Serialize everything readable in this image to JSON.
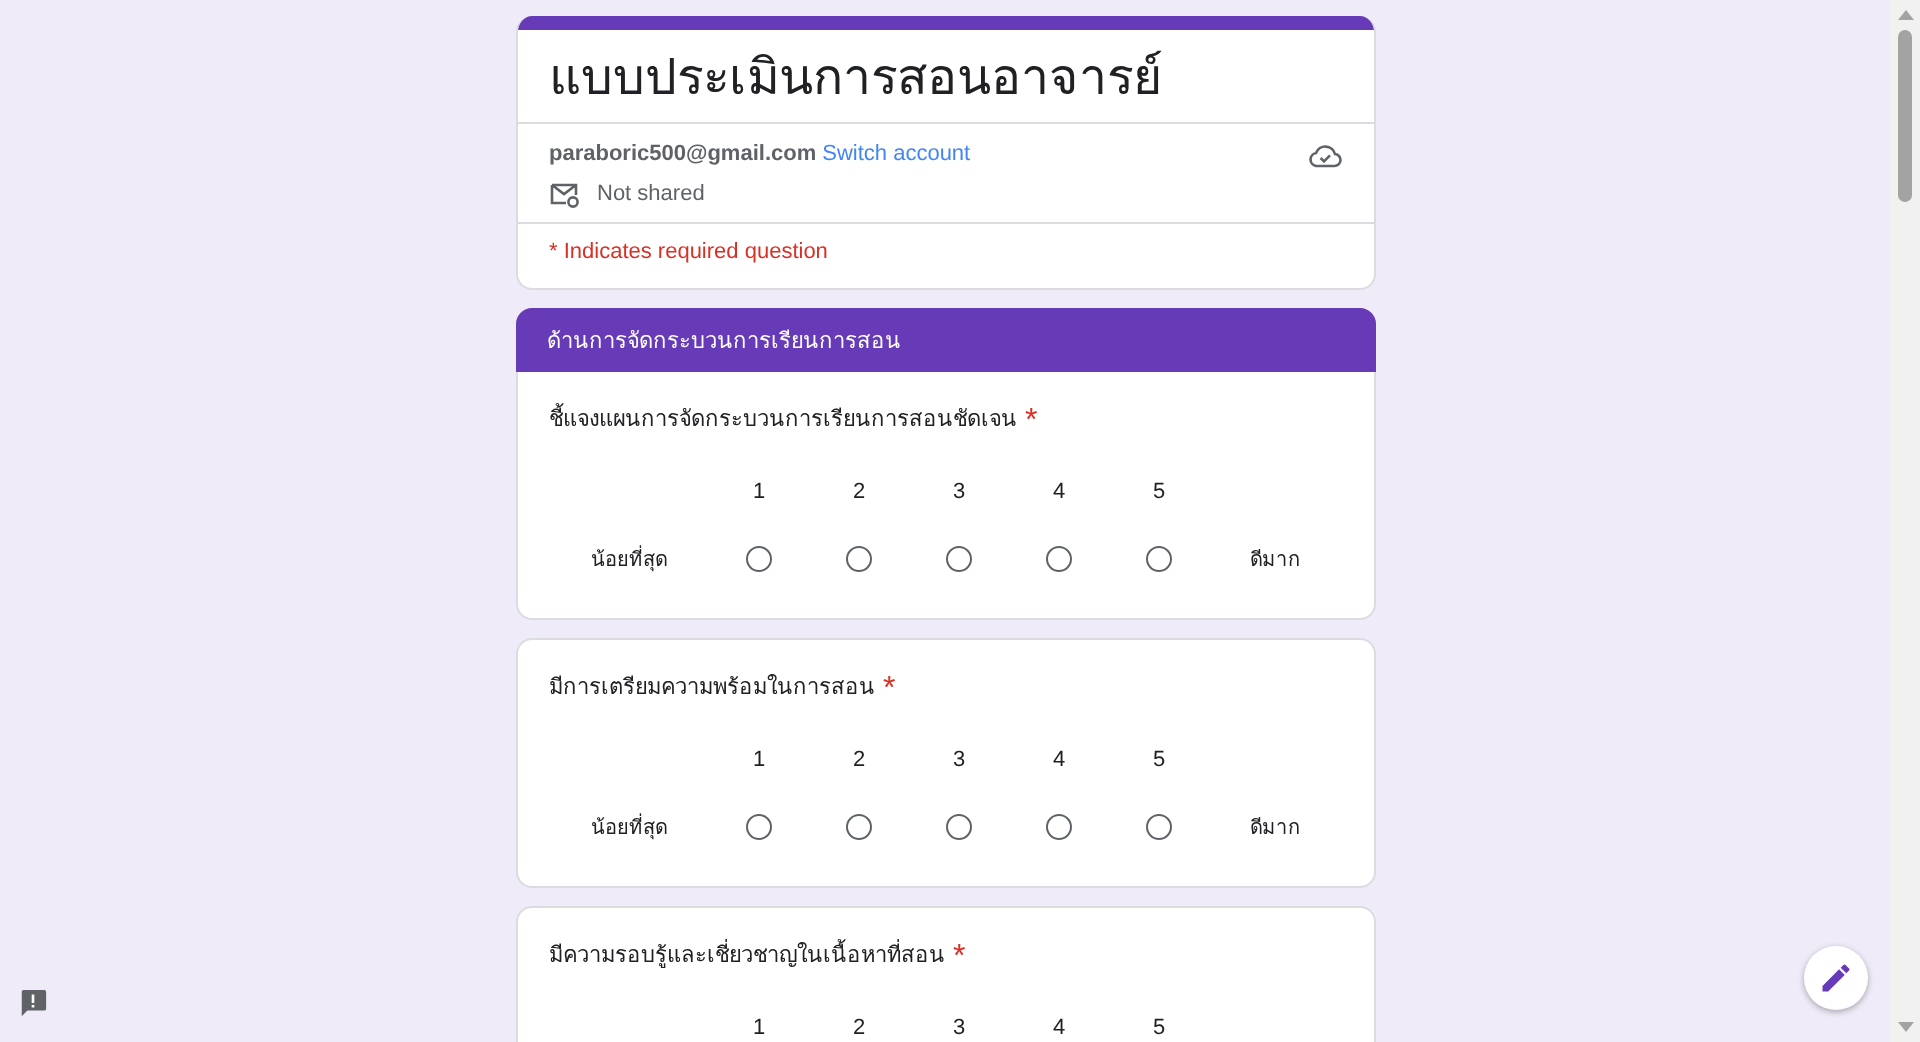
{
  "form": {
    "title": "แบบประเมินการสอนอาจารย์",
    "account_email": "paraboric500@gmail.com",
    "switch_account": "Switch account",
    "sharing": "Not shared",
    "required_note": "* Indicates required question"
  },
  "section": {
    "title": "ด้านการจัดกระบวนการเรียนการสอน"
  },
  "questions": [
    {
      "title": "ชี้แจงแผนการจัดกระบวนการเรียนการสอนชัดเจน",
      "required_mark": "*",
      "scale": [
        "1",
        "2",
        "3",
        "4",
        "5"
      ],
      "low_label": "น้อยที่สุด",
      "high_label": "ดีมาก",
      "options": [
        {
          "selected": false
        },
        {
          "selected": false
        },
        {
          "selected": false
        },
        {
          "selected": false
        },
        {
          "selected": false
        }
      ]
    },
    {
      "title": "มีการเตรียมความพร้อมในการสอน",
      "required_mark": "*",
      "scale": [
        "1",
        "2",
        "3",
        "4",
        "5"
      ],
      "low_label": "น้อยที่สุด",
      "high_label": "ดีมาก",
      "options": [
        {
          "selected": false
        },
        {
          "selected": false
        },
        {
          "selected": false
        },
        {
          "selected": false
        },
        {
          "selected": false
        }
      ]
    },
    {
      "title": "มีความรอบรู้และเชี่ยวชาญในเนื้อหาที่สอน",
      "required_mark": "*",
      "scale": [
        "1",
        "2",
        "3",
        "4",
        "5"
      ]
    }
  ]
}
